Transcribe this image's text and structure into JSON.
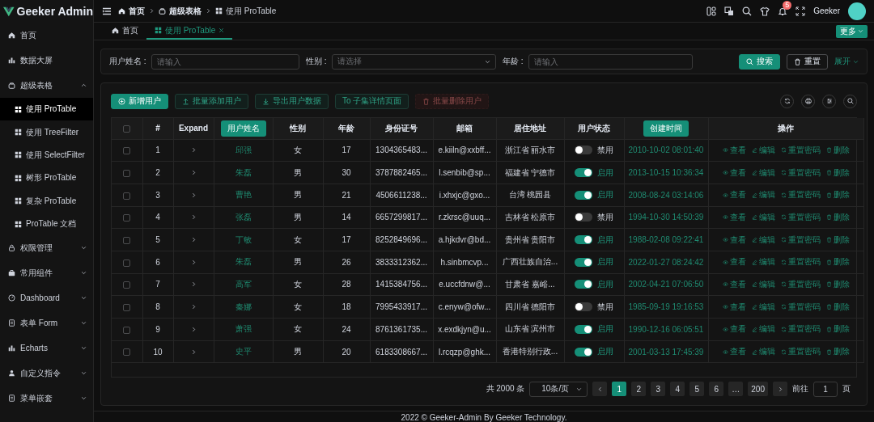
{
  "logo": {
    "title": "Geeker Admin"
  },
  "sidebar": {
    "items": [
      {
        "label": "首页"
      },
      {
        "label": "数据大屏"
      },
      {
        "label": "超级表格",
        "expanded": true,
        "children": [
          {
            "label": "使用 ProTable",
            "selected": true
          },
          {
            "label": "使用 TreeFilter",
            "selected": false
          },
          {
            "label": "使用 SelectFilter",
            "selected": false
          },
          {
            "label": "树形 ProTable",
            "selected": false
          },
          {
            "label": "复杂 ProTable",
            "selected": false
          },
          {
            "label": "ProTable 文档",
            "selected": false
          }
        ]
      },
      {
        "label": "权限管理",
        "expanded": false
      },
      {
        "label": "常用组件",
        "expanded": false
      },
      {
        "label": "Dashboard",
        "expanded": false
      },
      {
        "label": "表单 Form",
        "expanded": false
      },
      {
        "label": "Echarts",
        "expanded": false
      },
      {
        "label": "自定义指令",
        "expanded": false
      },
      {
        "label": "菜单嵌套",
        "expanded": false
      }
    ]
  },
  "header": {
    "breadcrumbs": [
      {
        "label": "首页"
      },
      {
        "label": "超级表格"
      },
      {
        "label": "使用 ProTable"
      }
    ],
    "notification_count": "5",
    "user": "Geeker"
  },
  "tabs": {
    "items": [
      {
        "label": "首页",
        "selected": false,
        "closable": false
      },
      {
        "label": "使用 ProTable",
        "selected": true,
        "closable": true
      }
    ],
    "more": "更多"
  },
  "search": {
    "fields": [
      {
        "label": "用户姓名 :",
        "placeholder": "请输入",
        "kind": "input"
      },
      {
        "label": "性别 :",
        "placeholder": "请选择",
        "kind": "select"
      },
      {
        "label": "年龄 :",
        "placeholder": "请输入",
        "kind": "input"
      }
    ],
    "search_button": "搜索",
    "reset_button": "重置",
    "expand_link": "展开"
  },
  "toolbar": {
    "buttons": [
      {
        "label": "新增用户",
        "kind": "primary",
        "disabled": false
      },
      {
        "label": "批量添加用户",
        "kind": "plain",
        "disabled": false
      },
      {
        "label": "导出用户数据",
        "kind": "plain",
        "disabled": false
      },
      {
        "label": "To 子集详情页面",
        "kind": "plain",
        "disabled": false
      },
      {
        "label": "批量删除用户",
        "kind": "danger",
        "disabled": true
      }
    ]
  },
  "table": {
    "select_all": {
      "checked": false
    },
    "columns": [
      {
        "label": "#",
        "kind": "text"
      },
      {
        "label": "Expand",
        "kind": "bold"
      },
      {
        "label": "用户姓名",
        "kind": "button"
      },
      {
        "label": "性别",
        "kind": "text"
      },
      {
        "label": "年龄",
        "kind": "text"
      },
      {
        "label": "身份证号",
        "kind": "text"
      },
      {
        "label": "邮箱",
        "kind": "text"
      },
      {
        "label": "居住地址",
        "kind": "text"
      },
      {
        "label": "用户状态",
        "kind": "text"
      },
      {
        "label": "创建时间",
        "kind": "button"
      },
      {
        "label": "操作",
        "kind": "text"
      }
    ],
    "rows": [
      {
        "checked": false,
        "index": "1",
        "name": "邱强",
        "gender": "女",
        "age": "17",
        "id_number": "1304365483...",
        "email": "e.kiiln@xxbff...",
        "address": "浙江省 丽水市",
        "enabled": false,
        "status": "禁用",
        "created": "2010-10-02 08:01:40",
        "actions": [
          "查看",
          "编辑",
          "重置密码",
          "删除"
        ]
      },
      {
        "checked": false,
        "index": "2",
        "name": "朱磊",
        "gender": "男",
        "age": "30",
        "id_number": "3787882465...",
        "email": "l.senbib@sp...",
        "address": "福建省 宁德市",
        "enabled": true,
        "status": "启用",
        "created": "2013-10-15 10:36:34",
        "actions": [
          "查看",
          "编辑",
          "重置密码",
          "删除"
        ]
      },
      {
        "checked": false,
        "index": "3",
        "name": "曹艳",
        "gender": "男",
        "age": "21",
        "id_number": "4506611238...",
        "email": "i.xhxjc@gxo...",
        "address": "台湾 桃园县",
        "enabled": true,
        "status": "启用",
        "created": "2008-08-24 03:14:06",
        "actions": [
          "查看",
          "编辑",
          "重置密码",
          "删除"
        ]
      },
      {
        "checked": false,
        "index": "4",
        "name": "张磊",
        "gender": "男",
        "age": "14",
        "id_number": "6657299817...",
        "email": "r.zkrsc@uuq...",
        "address": "吉林省 松原市",
        "enabled": false,
        "status": "禁用",
        "created": "1994-10-30 14:50:39",
        "actions": [
          "查看",
          "编辑",
          "重置密码",
          "删除"
        ]
      },
      {
        "checked": false,
        "index": "5",
        "name": "丁敏",
        "gender": "女",
        "age": "17",
        "id_number": "8252849696...",
        "email": "a.hjkdvr@bd...",
        "address": "贵州省 贵阳市",
        "enabled": true,
        "status": "启用",
        "created": "1988-02-08 09:22:41",
        "actions": [
          "查看",
          "编辑",
          "重置密码",
          "删除"
        ]
      },
      {
        "checked": false,
        "index": "6",
        "name": "朱磊",
        "gender": "男",
        "age": "26",
        "id_number": "3833312362...",
        "email": "h.sinbmcvp...",
        "address": "广西壮族自治...",
        "enabled": true,
        "status": "启用",
        "created": "2022-01-27 08:24:42",
        "actions": [
          "查看",
          "编辑",
          "重置密码",
          "删除"
        ]
      },
      {
        "checked": false,
        "index": "7",
        "name": "高军",
        "gender": "女",
        "age": "28",
        "id_number": "1415384756...",
        "email": "e.uccfdnw@...",
        "address": "甘肃省 嘉峪...",
        "enabled": true,
        "status": "启用",
        "created": "2002-04-21 07:06:50",
        "actions": [
          "查看",
          "编辑",
          "重置密码",
          "删除"
        ]
      },
      {
        "checked": false,
        "index": "8",
        "name": "秦娜",
        "gender": "女",
        "age": "18",
        "id_number": "7995433917...",
        "email": "c.enyw@ofw...",
        "address": "四川省 德阳市",
        "enabled": false,
        "status": "禁用",
        "created": "1985-09-19 19:16:53",
        "actions": [
          "查看",
          "编辑",
          "重置密码",
          "删除"
        ]
      },
      {
        "checked": false,
        "index": "9",
        "name": "萧强",
        "gender": "女",
        "age": "24",
        "id_number": "8761361735...",
        "email": "x.exdkjyn@u...",
        "address": "山东省 滨州市",
        "enabled": true,
        "status": "启用",
        "created": "1990-12-16 06:05:51",
        "actions": [
          "查看",
          "编辑",
          "重置密码",
          "删除"
        ]
      },
      {
        "checked": false,
        "index": "10",
        "name": "史平",
        "gender": "男",
        "age": "20",
        "id_number": "6183308667...",
        "email": "l.rcqzp@ghk...",
        "address": "香港特别行政...",
        "enabled": true,
        "status": "启用",
        "created": "2001-03-13 17:45:39",
        "actions": [
          "查看",
          "编辑",
          "重置密码",
          "删除"
        ]
      }
    ]
  },
  "pagination": {
    "total": "共 2000 条",
    "page_size": "10条/页",
    "pages": [
      {
        "label": "1",
        "selected": true
      },
      {
        "label": "2",
        "selected": false
      },
      {
        "label": "3",
        "selected": false
      },
      {
        "label": "4",
        "selected": false
      },
      {
        "label": "5",
        "selected": false
      },
      {
        "label": "6",
        "selected": false
      },
      {
        "label": "…",
        "selected": false
      },
      {
        "label": "200",
        "selected": false
      }
    ],
    "goto_label": "前往",
    "goto_value": "1",
    "goto_suffix": "页"
  },
  "footer": {
    "text": "2022 © Geeker-Admin By Geeker Technology."
  }
}
